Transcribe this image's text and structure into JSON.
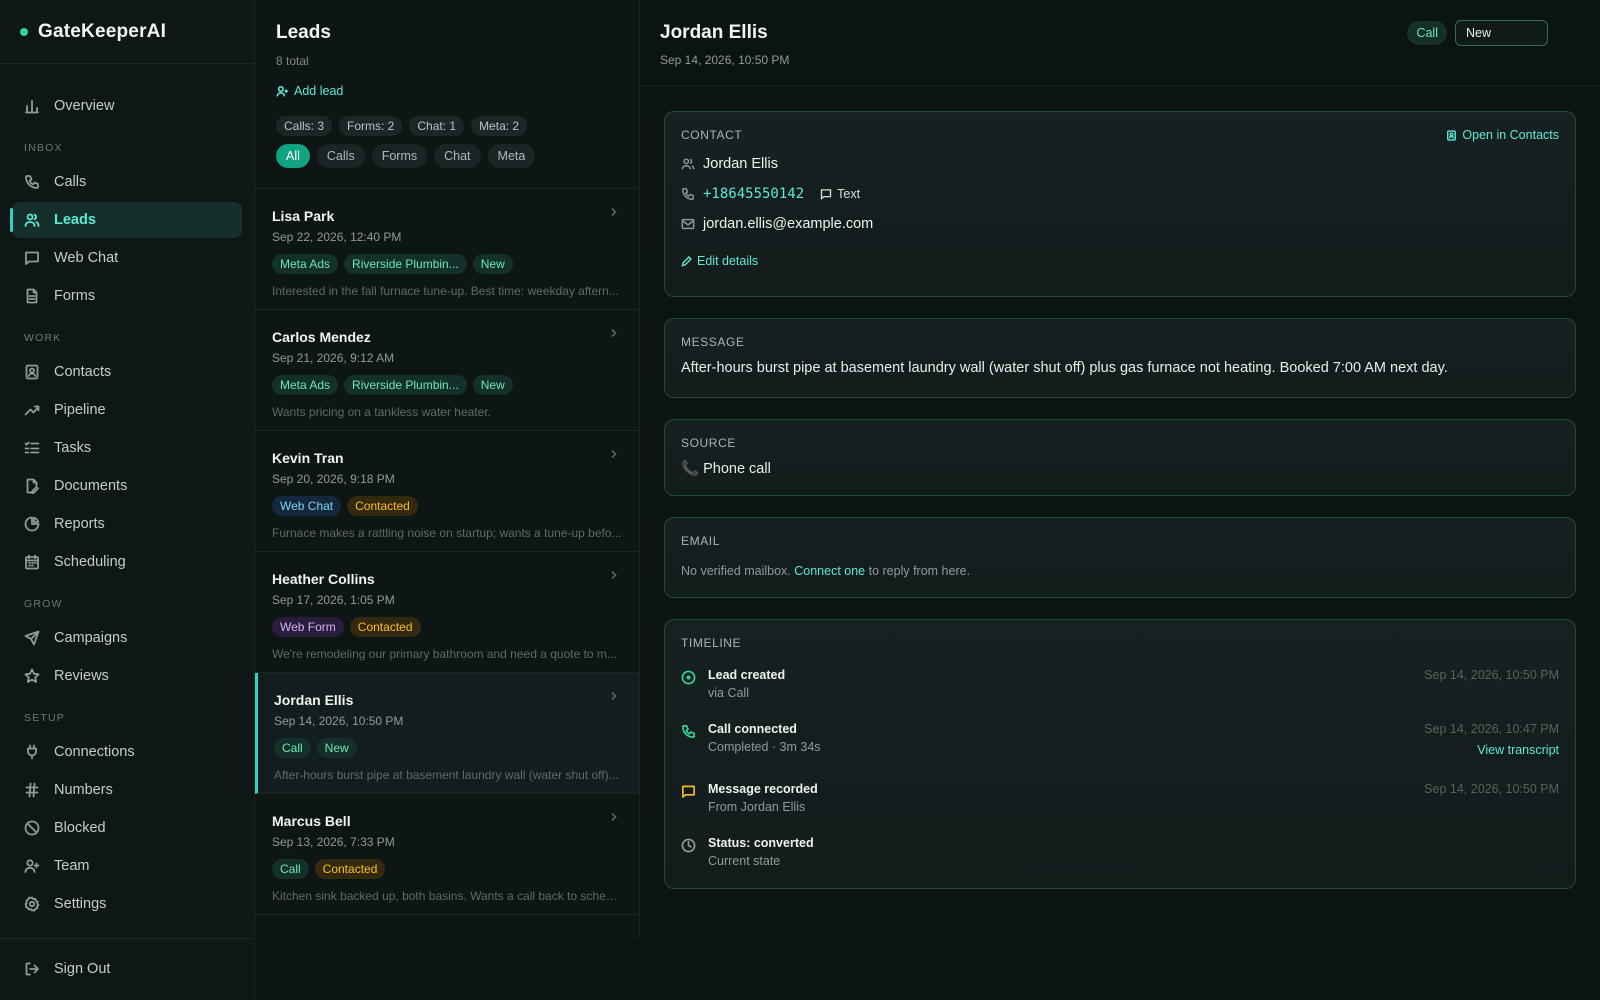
{
  "app": {
    "name": "GateKeeperAI",
    "brand_color": "#34d399"
  },
  "sidebar": {
    "top": [
      {
        "label": "Overview",
        "icon": "bar-chart-icon"
      }
    ],
    "sections": [
      {
        "title": "INBOX",
        "items": [
          {
            "label": "Calls",
            "icon": "phone-icon",
            "active": false
          },
          {
            "label": "Leads",
            "icon": "users-icon",
            "active": true
          },
          {
            "label": "Web Chat",
            "icon": "chat-icon",
            "active": false
          },
          {
            "label": "Forms",
            "icon": "file-icon",
            "active": false
          }
        ]
      },
      {
        "title": "WORK",
        "items": [
          {
            "label": "Contacts",
            "icon": "contact-book-icon"
          },
          {
            "label": "Pipeline",
            "icon": "trend-up-icon"
          },
          {
            "label": "Tasks",
            "icon": "checklist-icon"
          },
          {
            "label": "Documents",
            "icon": "document-edit-icon"
          },
          {
            "label": "Reports",
            "icon": "pie-chart-icon"
          },
          {
            "label": "Scheduling",
            "icon": "calendar-icon"
          }
        ]
      },
      {
        "title": "GROW",
        "items": [
          {
            "label": "Campaigns",
            "icon": "send-icon"
          },
          {
            "label": "Reviews",
            "icon": "star-icon"
          }
        ]
      },
      {
        "title": "SETUP",
        "items": [
          {
            "label": "Connections",
            "icon": "plug-icon"
          },
          {
            "label": "Numbers",
            "icon": "hash-icon"
          },
          {
            "label": "Blocked",
            "icon": "ban-icon"
          },
          {
            "label": "Team",
            "icon": "user-plus-icon"
          },
          {
            "label": "Settings",
            "icon": "gear-icon"
          }
        ]
      }
    ],
    "sign_out": "Sign Out"
  },
  "leads": {
    "title": "Leads",
    "total": "8 total",
    "add_lead": "Add lead",
    "stats": [
      "Calls: 3",
      "Forms: 2",
      "Chat: 1",
      "Meta: 2"
    ],
    "filters": [
      "All",
      "Calls",
      "Forms",
      "Chat",
      "Meta"
    ],
    "active_filter": "All",
    "items": [
      {
        "name": "Lisa Park",
        "date": "Sep 22, 2026, 12:40 PM",
        "tags": [
          {
            "text": "Meta Ads",
            "color": "green"
          },
          {
            "text": "Riverside Plumbin...",
            "color": "green"
          },
          {
            "text": "New",
            "color": "green"
          }
        ],
        "preview": "Interested in the fall furnace tune-up. Best time: weekday aftern..."
      },
      {
        "name": "Carlos Mendez",
        "date": "Sep 21, 2026, 9:12 AM",
        "tags": [
          {
            "text": "Meta Ads",
            "color": "green"
          },
          {
            "text": "Riverside Plumbin...",
            "color": "green"
          },
          {
            "text": "New",
            "color": "green"
          }
        ],
        "preview": "Wants pricing on a tankless water heater."
      },
      {
        "name": "Kevin Tran",
        "date": "Sep 20, 2026, 9:18 PM",
        "tags": [
          {
            "text": "Web Chat",
            "color": "blue"
          },
          {
            "text": "Contacted",
            "color": "amber"
          }
        ],
        "preview": "Furnace makes a rattling noise on startup; wants a tune-up befo..."
      },
      {
        "name": "Heather Collins",
        "date": "Sep 17, 2026, 1:05 PM",
        "tags": [
          {
            "text": "Web Form",
            "color": "purple"
          },
          {
            "text": "Contacted",
            "color": "amber"
          }
        ],
        "preview": "We're remodeling our primary bathroom and need a quote to m..."
      },
      {
        "name": "Jordan Ellis",
        "date": "Sep 14, 2026, 10:50 PM",
        "selected": true,
        "tags": [
          {
            "text": "Call",
            "color": "green"
          },
          {
            "text": "New",
            "color": "green"
          }
        ],
        "preview": "After-hours burst pipe at basement laundry wall (water shut off)..."
      },
      {
        "name": "Marcus Bell",
        "date": "Sep 13, 2026, 7:33 PM",
        "tags": [
          {
            "text": "Call",
            "color": "green"
          },
          {
            "text": "Contacted",
            "color": "amber"
          }
        ],
        "preview": "Kitchen sink backed up, both basins. Wants a call back to sched..."
      }
    ]
  },
  "detail": {
    "name": "Jordan Ellis",
    "date": "Sep 14, 2026, 10:50 PM",
    "source_badge": "Call",
    "status_value": "New",
    "contact": {
      "label": "CONTACT",
      "open_link": "Open in Contacts",
      "name": "Jordan Ellis",
      "phone": "+18645550142",
      "text_btn": "Text",
      "email": "jordan.ellis@example.com",
      "edit": "Edit details"
    },
    "message": {
      "label": "MESSAGE",
      "text": "After-hours burst pipe at basement laundry wall (water shut off) plus gas furnace not heating. Booked 7:00 AM next day."
    },
    "source": {
      "label": "SOURCE",
      "text": "📞 Phone call"
    },
    "email_section": {
      "label": "EMAIL",
      "pre": "No verified mailbox.",
      "link": "Connect one",
      "post": "to reply from here."
    },
    "timeline": {
      "label": "TIMELINE",
      "items": [
        {
          "title": "Lead created",
          "sub": "via Call",
          "time": "Sep 14, 2026, 10:50 PM",
          "icon": "circle-dot-icon",
          "color": "#34d399"
        },
        {
          "title": "Call connected",
          "sub": "Completed · 3m 34s",
          "time": "Sep 14, 2026, 10:47 PM",
          "link": "View transcript",
          "icon": "phone-icon",
          "color": "#34d399"
        },
        {
          "title": "Message recorded",
          "sub": "From Jordan Ellis",
          "time": "Sep 14, 2026, 10:50 PM",
          "icon": "message-icon",
          "color": "#f5b82e"
        },
        {
          "title": "Status: converted",
          "sub": "Current state",
          "time": "",
          "icon": "clock-icon",
          "color": "#8e9b9b"
        }
      ]
    }
  }
}
